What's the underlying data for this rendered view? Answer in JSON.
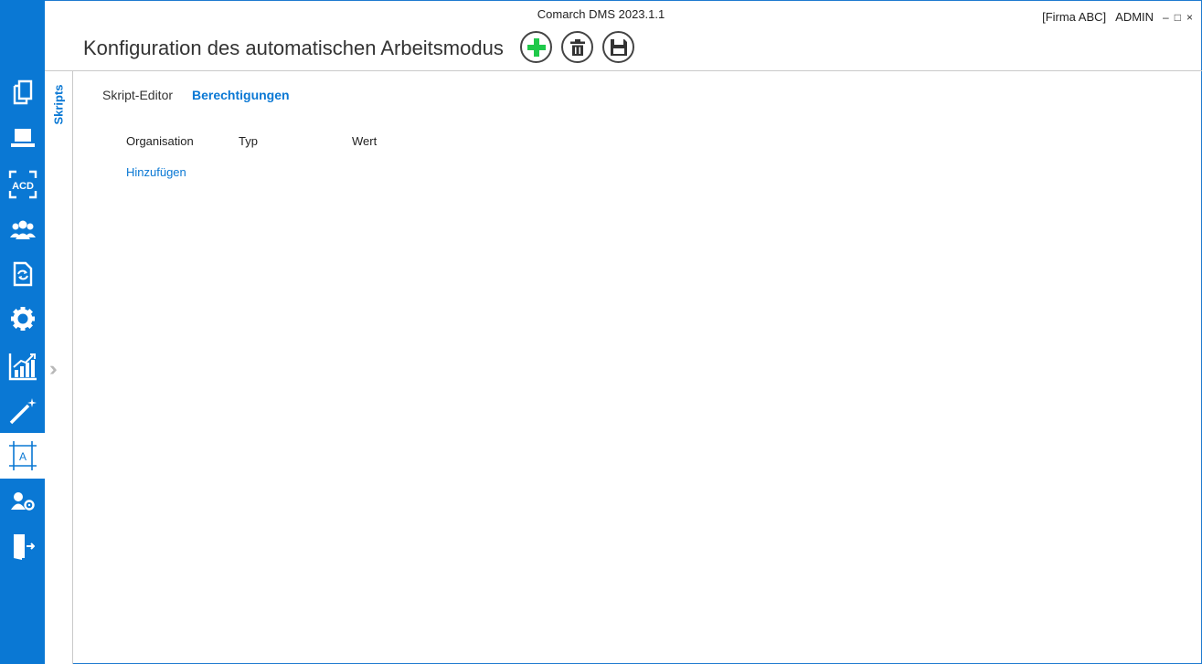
{
  "window": {
    "title": "Comarch DMS 2023.1.1",
    "company": "[Firma ABC]",
    "user": "ADMIN",
    "minimize_glyph": "–",
    "maximize_glyph": "□",
    "close_glyph": "×"
  },
  "page": {
    "title": "Konfiguration des automatischen Arbeitsmodus"
  },
  "toolbar": {
    "add_icon": "plus-icon",
    "delete_icon": "trash-icon",
    "save_icon": "floppy-icon"
  },
  "nav": {
    "items": [
      {
        "icon": "documents-icon"
      },
      {
        "icon": "laptop-icon"
      },
      {
        "icon": "acd-icon",
        "label": "ACD"
      },
      {
        "icon": "users-icon"
      },
      {
        "icon": "workflow-document-icon"
      },
      {
        "icon": "gear-icon"
      },
      {
        "icon": "chart-icon"
      },
      {
        "icon": "magic-wand-icon"
      },
      {
        "icon": "ocr-frame-icon",
        "label": "A",
        "active": true
      },
      {
        "icon": "user-settings-icon"
      },
      {
        "icon": "exit-door-icon"
      }
    ]
  },
  "side_tab": {
    "label": "Skripts"
  },
  "tabs": [
    {
      "label": "Skript-Editor"
    },
    {
      "label": "Berechtigungen",
      "active": true
    }
  ],
  "table": {
    "columns": [
      "Organisation",
      "Typ",
      "Wert"
    ],
    "add_label": "Hinzufügen"
  },
  "colors": {
    "nav_bg": "#0a78d4",
    "accent": "#0a78d4",
    "add_green": "#1fc94a"
  }
}
